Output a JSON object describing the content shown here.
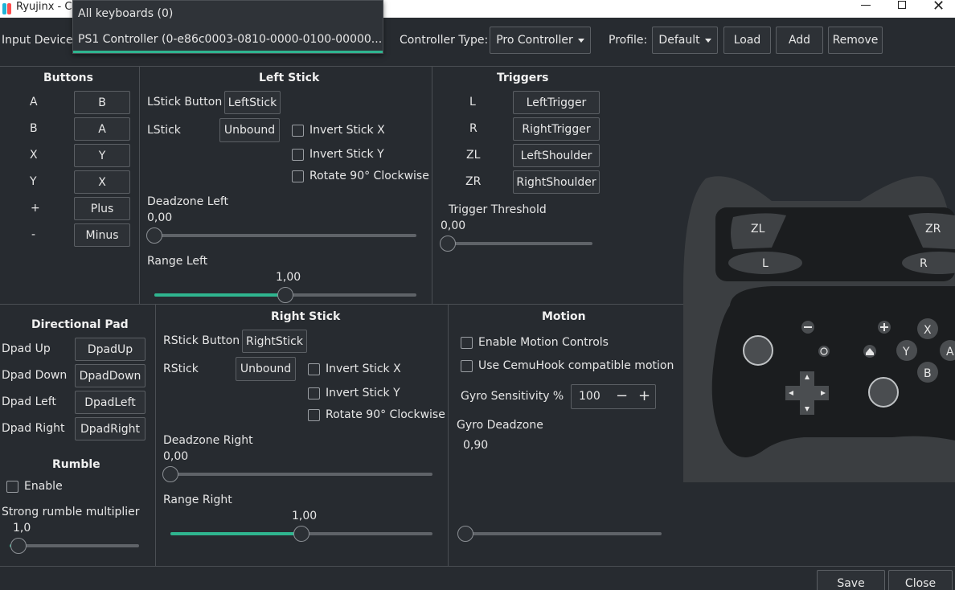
{
  "window": {
    "title": "Ryujinx - Co"
  },
  "dropdown_popup": {
    "items": [
      "All keyboards (0)",
      "PS1 Controller (0-e86c0003-0810-0000-0100-00000..."
    ]
  },
  "toolbar": {
    "input_device_label": "Input Device",
    "controller_type_label": "Controller Type:",
    "controller_type_value": "Pro Controller",
    "profile_label": "Profile:",
    "profile_value": "Default",
    "load": "Load",
    "add": "Add",
    "remove": "Remove"
  },
  "buttons": {
    "title": "Buttons",
    "rows": [
      {
        "key": "A",
        "value": "B"
      },
      {
        "key": "B",
        "value": "A"
      },
      {
        "key": "X",
        "value": "Y"
      },
      {
        "key": "Y",
        "value": "X"
      },
      {
        "key": "+",
        "value": "Plus"
      },
      {
        "key": "-",
        "value": "Minus"
      }
    ]
  },
  "left_stick": {
    "title": "Left Stick",
    "button_label": "LStick Button",
    "button_value": "LeftStick",
    "stick_label": "LStick",
    "stick_value": "Unbound",
    "invert_x": "Invert Stick X",
    "invert_y": "Invert Stick Y",
    "rotate": "Rotate 90° Clockwise",
    "deadzone_label": "Deadzone Left",
    "deadzone_value": "0,00",
    "deadzone_fraction": 0.0,
    "range_label": "Range Left",
    "range_value": "1,00",
    "range_fraction": 0.5
  },
  "triggers": {
    "title": "Triggers",
    "rows": [
      {
        "key": "L",
        "value": "LeftTrigger"
      },
      {
        "key": "R",
        "value": "RightTrigger"
      },
      {
        "key": "ZL",
        "value": "LeftShoulder"
      },
      {
        "key": "ZR",
        "value": "RightShoulder"
      }
    ],
    "threshold_label": "Trigger Threshold",
    "threshold_value": "0,00",
    "threshold_fraction": 0.0
  },
  "dpad": {
    "title": "Directional Pad",
    "rows": [
      {
        "key": "Dpad Up",
        "value": "DpadUp"
      },
      {
        "key": "Dpad Down",
        "value": "DpadDown"
      },
      {
        "key": "Dpad Left",
        "value": "DpadLeft"
      },
      {
        "key": "Dpad Right",
        "value": "DpadRight"
      }
    ]
  },
  "rumble": {
    "title": "Rumble",
    "enable": "Enable",
    "multiplier_label": "Strong rumble multiplier",
    "multiplier_value": "1,0",
    "multiplier_fraction": 0.07
  },
  "right_stick": {
    "title": "Right Stick",
    "button_label": "RStick Button",
    "button_value": "RightStick",
    "stick_label": "RStick",
    "stick_value": "Unbound",
    "invert_x": "Invert Stick X",
    "invert_y": "Invert Stick Y",
    "rotate": "Rotate 90° Clockwise",
    "deadzone_label": "Deadzone Right",
    "deadzone_value": "0,00",
    "deadzone_fraction": 0.0,
    "range_label": "Range Right",
    "range_value": "1,00",
    "range_fraction": 0.5
  },
  "motion": {
    "title": "Motion",
    "enable_motion": "Enable Motion Controls",
    "cemuhook": "Use CemuHook compatible motion",
    "gyro_sensitivity_label": "Gyro Sensitivity %",
    "gyro_sensitivity_value": "100",
    "gyro_deadzone_label": "Gyro Deadzone",
    "gyro_deadzone_value": "0,90",
    "gyro_deadzone_fraction": 0.0
  },
  "controller_image": {
    "labels": {
      "zl": "ZL",
      "zr": "ZR",
      "l": "L",
      "r": "R",
      "x": "X",
      "y": "Y",
      "a": "A",
      "b": "B"
    }
  },
  "footer": {
    "save": "Save",
    "close": "Close"
  },
  "colors": {
    "accent": "#2fb58f",
    "background": "#272b30"
  }
}
